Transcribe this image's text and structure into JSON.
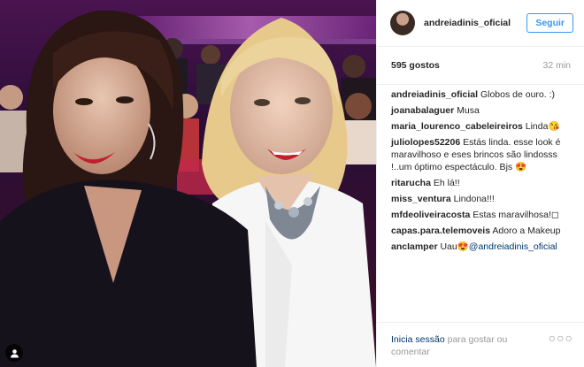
{
  "post": {
    "username": "andreiadinis_oficial",
    "follow_label": "Seguir",
    "likes": "595 gostos",
    "time": "32 min"
  },
  "comments": [
    {
      "user": "andreiadinis_oficial",
      "text": "Globos de ouro. :)"
    },
    {
      "user": "joanabalaguer",
      "text": "Musa"
    },
    {
      "user": "maria_lourenco_cabeleireiros",
      "text": "Linda😘"
    },
    {
      "user": "juliolopes52206",
      "text": "Estás linda. esse look é maravilhoso e eses brincos são lindosss !..um óptimo espectáculo. Bjs 😍"
    },
    {
      "user": "ritarucha",
      "text": "Eh lá!!"
    },
    {
      "user": "miss_ventura",
      "text": "Lindona!!!"
    },
    {
      "user": "mfdeoliveiracosta",
      "text": "Estas maravilhosa!◻"
    },
    {
      "user": "capas.para.telemoveis",
      "text": "Adoro a Makeup"
    },
    {
      "user": "ancIamper",
      "text": "Uau😍",
      "mention": "@andreiadinis_oficial"
    }
  ],
  "footer": {
    "login_link": "Inicia sessão",
    "login_rest": " para gostar ou comentar",
    "more": "○○○"
  },
  "colors": {
    "link": "#3897f0",
    "text": "#262626",
    "muted": "#999999",
    "mention": "#003569"
  },
  "icons": {
    "tag": "person-tag-icon",
    "more": "more-options-icon"
  }
}
